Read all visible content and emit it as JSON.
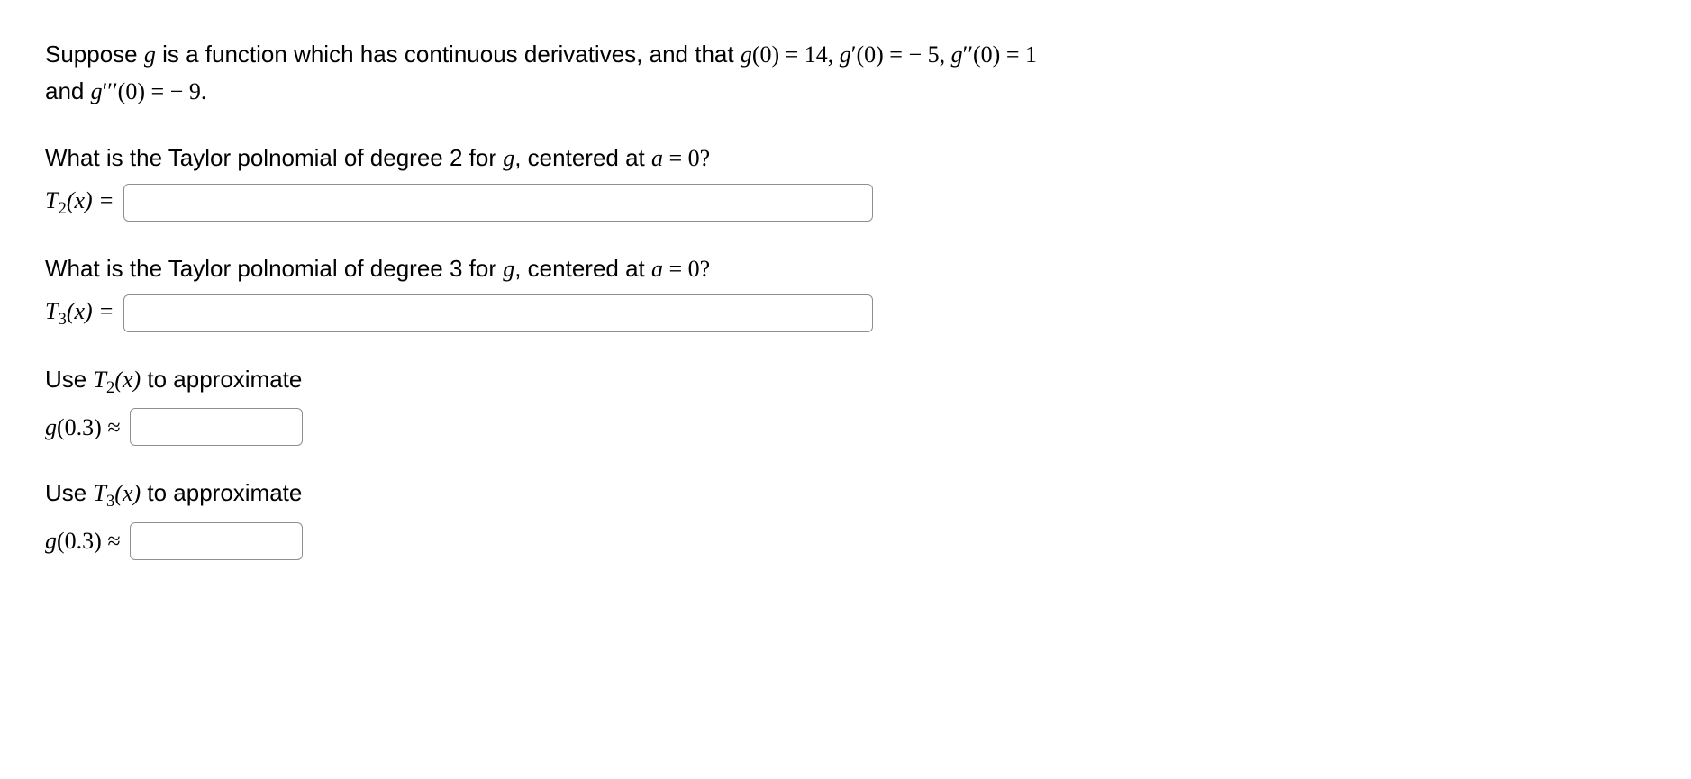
{
  "intro": {
    "p1a": "Suppose ",
    "g": "g",
    "p1b": " is a function which has continuous derivatives, and that ",
    "g0": "g",
    "g0paren": "(0) = 14, ",
    "gp": "g",
    "gp_prime": "′",
    "gp_val": "(0) =  − 5, ",
    "gpp": "g",
    "gpp_prime": "′′",
    "gpp_val": "(0) = 1",
    "p2a": "and ",
    "gppp": "g",
    "gppp_prime": "′′′",
    "gppp_val": "(0) =  − 9."
  },
  "q1": {
    "text_a": "What is the Taylor polnomial of degree 2 for ",
    "g": "g",
    "text_b": ", centered at ",
    "a": "a",
    "text_c": " = 0?",
    "label_T": "T",
    "label_sub": "2",
    "label_x": "(x) = "
  },
  "q2": {
    "text_a": "What is the Taylor polnomial of degree 3 for ",
    "g": "g",
    "text_b": ", centered at ",
    "a": "a",
    "text_c": " = 0?",
    "label_T": "T",
    "label_sub": "3",
    "label_x": "(x) = "
  },
  "q3": {
    "text_a": "Use ",
    "T": "T",
    "sub": "2",
    "x": "(x)",
    "text_b": " to approximate",
    "g": "g",
    "gval": "(0.3) ≈ "
  },
  "q4": {
    "text_a": "Use ",
    "T": "T",
    "sub": "3",
    "x": "(x)",
    "text_b": " to approximate",
    "g": "g",
    "gval": "(0.3) ≈ "
  }
}
